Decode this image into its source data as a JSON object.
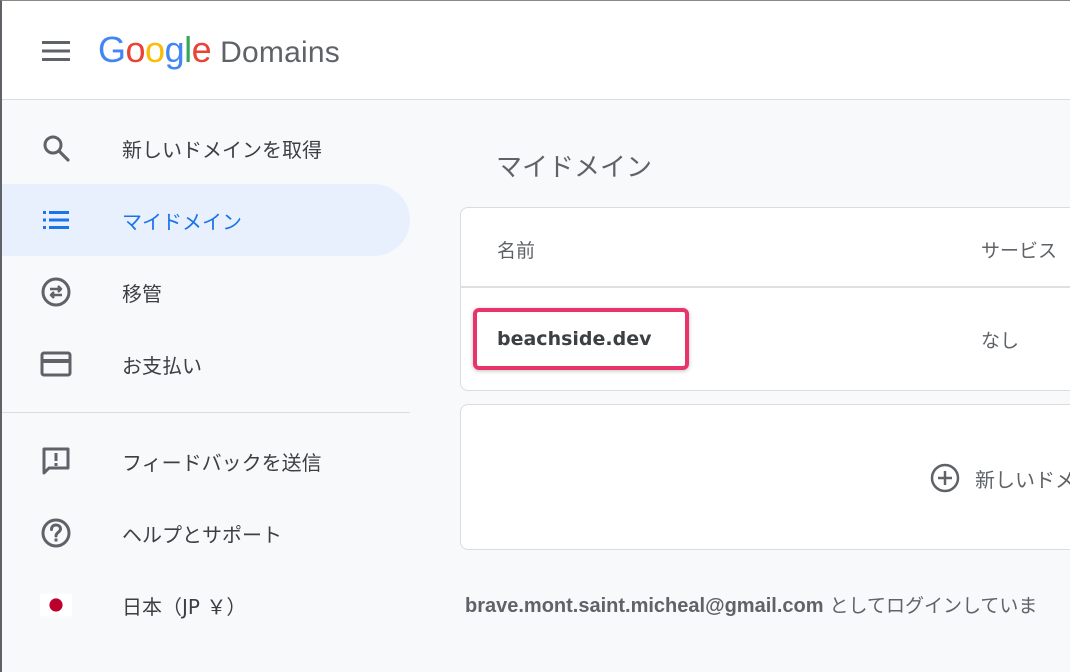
{
  "header": {
    "logo_google": [
      "G",
      "o",
      "o",
      "g",
      "l",
      "e"
    ],
    "logo_domains": "Domains"
  },
  "sidebar": {
    "items": [
      {
        "label": "新しいドメインを取得",
        "icon": "search-icon"
      },
      {
        "label": "マイドメイン",
        "icon": "list-icon",
        "active": true
      },
      {
        "label": "移管",
        "icon": "transfer-icon"
      },
      {
        "label": "お支払い",
        "icon": "credit-card-icon"
      },
      {
        "label": "フィードバックを送信",
        "icon": "feedback-icon"
      },
      {
        "label": "ヘルプとサポート",
        "icon": "help-icon"
      },
      {
        "label": "日本（JP ￥）",
        "icon": "japan-flag-icon"
      }
    ]
  },
  "main": {
    "title": "マイドメイン",
    "table": {
      "headers": {
        "name": "名前",
        "service": "サービス"
      },
      "rows": [
        {
          "name": "beachside.dev",
          "service": "なし"
        }
      ]
    },
    "add_domain_label": "新しいドメ",
    "login": {
      "email": "brave.mont.saint.micheal@gmail.com",
      "suffix": " としてログインしていま"
    }
  },
  "colors": {
    "accent": "#1a73e8",
    "active_bg": "#e8f0fe",
    "highlight": "#e8336b",
    "google_blue": "#4285f4",
    "google_red": "#ea4335",
    "google_yellow": "#fbbc05",
    "google_green": "#34a853"
  }
}
